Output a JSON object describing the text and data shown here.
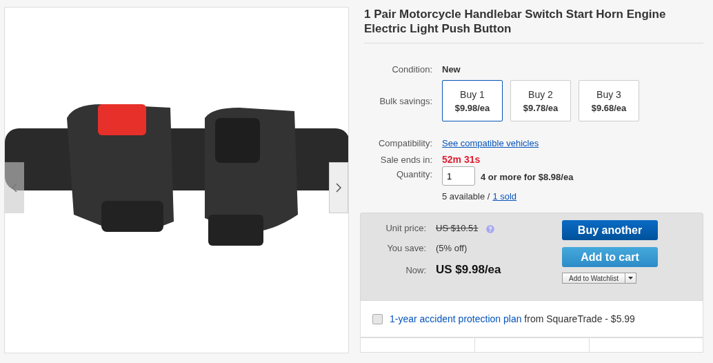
{
  "title": "1 Pair Motorcycle Handlebar Switch Start Horn Engine Electric Light Push Button",
  "condition": {
    "label": "Condition:",
    "value": "New"
  },
  "bulk_savings": {
    "label": "Bulk savings:",
    "options": [
      {
        "label": "Buy 1",
        "price": "$9.98/ea",
        "selected": true
      },
      {
        "label": "Buy 2",
        "price": "$9.78/ea",
        "selected": false
      },
      {
        "label": "Buy 3",
        "price": "$9.68/ea",
        "selected": false
      }
    ]
  },
  "compatibility": {
    "label": "Compatibility:",
    "link": "See compatible vehicles"
  },
  "sale": {
    "label": "Sale ends in:",
    "countdown": "52m 31s"
  },
  "quantity": {
    "label": "Quantity:",
    "value": "1",
    "note": "4 or more for $8.98/ea"
  },
  "availability": {
    "text": "5 available /",
    "link": "1 sold"
  },
  "purchase": {
    "unit_price_label": "Unit price:",
    "unit_price": "US $10.51",
    "you_save_label": "You save:",
    "you_save": "(5% off)",
    "now_label": "Now:",
    "now_price": "US $9.98/ea",
    "buy_another": "Buy another",
    "add_to_cart": "Add to cart",
    "watchlist": "Add to Watchlist"
  },
  "protection": {
    "checked": false,
    "link": "1-year accident protection plan",
    "text": "from SquareTrade - $5.99"
  }
}
